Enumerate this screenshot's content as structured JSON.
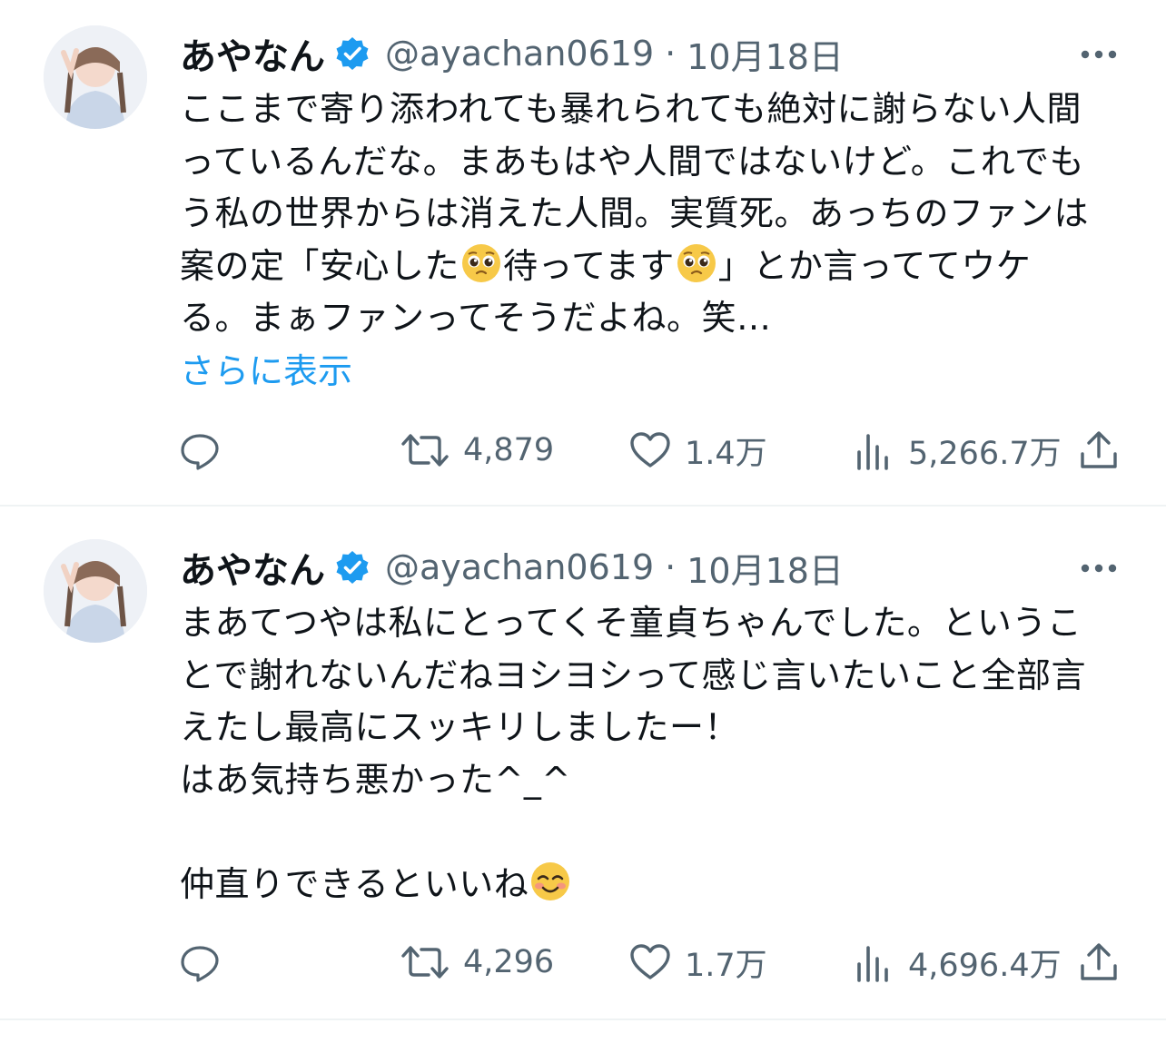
{
  "tweets": [
    {
      "display_name": "あやなん",
      "verified_icon": "verified-badge-icon",
      "handle": "@ayachan0619",
      "separator": "·",
      "date": "10月18日",
      "text_lines": [
        "ここまで寄り添われても暴れられても絶対に謝らない人間",
        "っているんだな。まあもはや人間ではないけど。これでも",
        "う私の世界からは消えた人間。実質死。あっちのファンは",
        "案の定「安心した🥹待ってます🥹」とか言っててウケ",
        "る。まぁファンってそうだよね。笑…"
      ],
      "line4_parts": [
        "案の定「安心した",
        "待ってます",
        "」とか言っててウケ"
      ],
      "show_more": "さらに表示",
      "retweets": "4,879",
      "likes": "1.4万",
      "views": "5,266.7万"
    },
    {
      "display_name": "あやなん",
      "verified_icon": "verified-badge-icon",
      "handle": "@ayachan0619",
      "separator": "·",
      "date": "10月18日",
      "text_lines": [
        "まあてつやは私にとってくそ童貞ちゃんでした。というこ",
        "とで謝れないんだねヨシヨシって感じ言いたいこと全部言",
        "えたし最高にスッキリしましたー！",
        "はあ気持ち悪かった^_^",
        "",
        "仲直りできるといいね😊"
      ],
      "last_line_text": "仲直りできるといいね",
      "retweets": "4,296",
      "likes": "1.7万",
      "views": "4,696.4万"
    }
  ],
  "icons": {
    "reply": "reply-icon",
    "retweet": "retweet-icon",
    "like": "like-icon",
    "views": "views-icon",
    "share": "share-icon",
    "more": "more-icon"
  },
  "colors": {
    "text": "#0f1419",
    "secondary": "#536471",
    "link": "#1d9bf0",
    "divider": "#eff3f4"
  }
}
